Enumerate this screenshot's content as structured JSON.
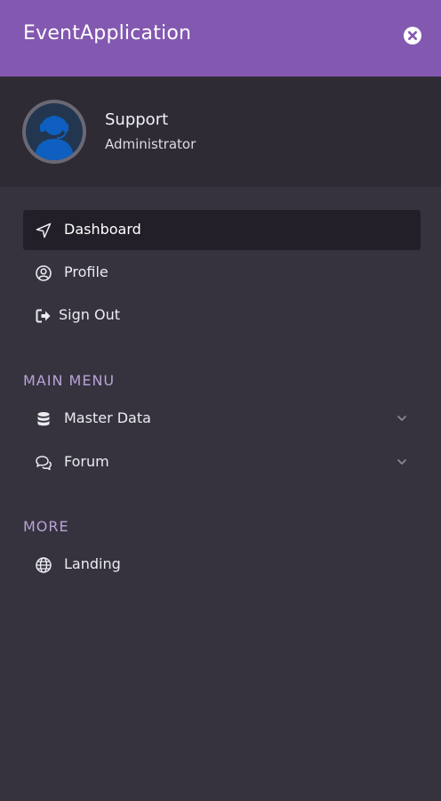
{
  "header": {
    "title": "EventApplication",
    "close_icon": "close-circle-icon",
    "bg_color": "#8358b0"
  },
  "profile": {
    "name": "Support",
    "role": "Administrator",
    "avatar_icon": "support-agent-avatar"
  },
  "nav": {
    "items": [
      {
        "label": "Dashboard",
        "icon": "navigation-arrow-icon",
        "active": true
      },
      {
        "label": "Profile",
        "icon": "user-circle-icon",
        "active": false
      },
      {
        "label": "Sign Out",
        "icon": "sign-out-icon",
        "active": false
      }
    ]
  },
  "main_menu": {
    "title": "MAIN MENU",
    "items": [
      {
        "label": "Master Data",
        "icon": "database-icon",
        "expandable": true
      },
      {
        "label": "Forum",
        "icon": "comments-icon",
        "expandable": true
      }
    ]
  },
  "more": {
    "title": "MORE",
    "items": [
      {
        "label": "Landing",
        "icon": "globe-icon"
      }
    ]
  },
  "colors": {
    "accent": "#8358b0",
    "section_title": "#b8a3d6",
    "background": "#36333f",
    "active_item": "#221f28"
  }
}
